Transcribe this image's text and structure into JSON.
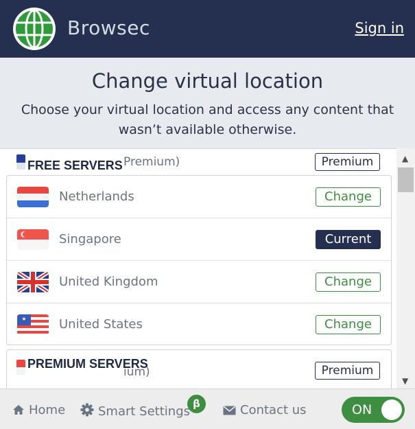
{
  "header": {
    "brand": "Browsec",
    "signin_label": "Sign in",
    "logo_icon": "globe-logo-icon"
  },
  "intro": {
    "title": "Change virtual location",
    "text": "Choose your virtual location and access any content that wasn’t available otherwise."
  },
  "free_section": {
    "label": "FREE SERVERS",
    "ghost_text": "Premium)",
    "premium_label": "Premium"
  },
  "servers": [
    {
      "country": "Netherlands",
      "action": "Change",
      "flag": "netherlands-flag-icon"
    },
    {
      "country": "Singapore",
      "action": "Current",
      "flag": "singapore-flag-icon"
    },
    {
      "country": "United Kingdom",
      "action": "Change",
      "flag": "uk-flag-icon"
    },
    {
      "country": "United States",
      "action": "Change",
      "flag": "us-flag-icon"
    }
  ],
  "premium_section": {
    "label": "PREMIUM SERVERS",
    "ghost_text": "ium)",
    "premium_label": "Premium"
  },
  "footer": {
    "home_label": "Home",
    "smart_label": "Smart Settings",
    "beta_badge": "β",
    "contact_label": "Contact us",
    "toggle_label": "ON"
  },
  "colors": {
    "header_bg": "#253050",
    "accent_green": "#3e8e41",
    "intro_bg": "#e7ebef"
  }
}
